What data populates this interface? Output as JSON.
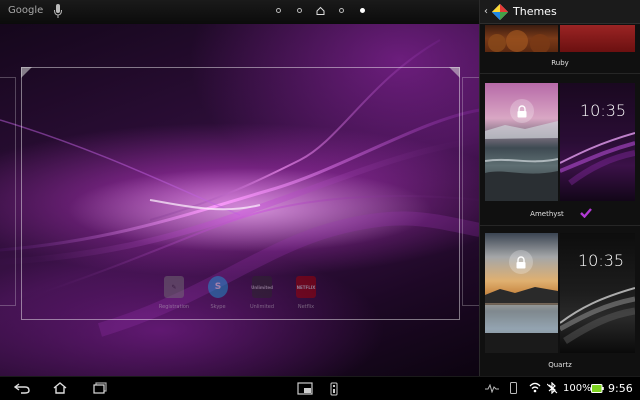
{
  "topbar": {
    "search_label": "Google",
    "page_indicators": [
      {
        "type": "dot",
        "current": false
      },
      {
        "type": "dot",
        "current": false
      },
      {
        "type": "home",
        "current": false
      },
      {
        "type": "dot",
        "current": false
      },
      {
        "type": "dot",
        "current": true
      }
    ]
  },
  "dock": {
    "apps": [
      {
        "label": "Registration",
        "icon": "registration-icon",
        "glyph": "✎",
        "color": "#7a7a7a"
      },
      {
        "label": "Skype",
        "icon": "skype-icon",
        "glyph": "S",
        "color": "#1aa3e0"
      },
      {
        "label": "Unlimited",
        "icon": "unlimited-icon",
        "glyph": "Unlimited",
        "color": "#2a2a2a"
      },
      {
        "label": "Netflix",
        "icon": "netflix-icon",
        "glyph": "NETFLIX",
        "color": "#b00000"
      }
    ]
  },
  "themes_panel": {
    "title": "Themes",
    "themes": [
      {
        "name": "Ruby",
        "selected": false
      },
      {
        "name": "Amethyst",
        "selected": true,
        "clock": "10:35"
      },
      {
        "name": "Quartz",
        "selected": false,
        "clock": "10:35"
      }
    ]
  },
  "statusbar": {
    "battery": "100%",
    "time": "9:56"
  },
  "colors": {
    "accent": "#b13ad4",
    "panel_bg": "#101010"
  }
}
